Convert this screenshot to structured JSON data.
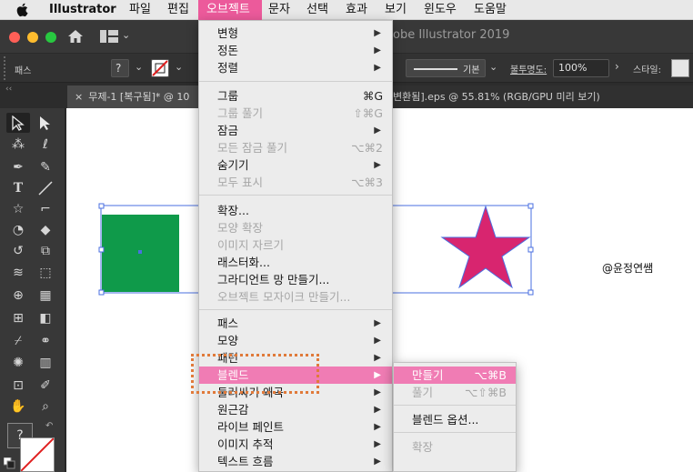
{
  "menubar": {
    "apple": "",
    "app": "Illustrator",
    "items": [
      "파일",
      "편집",
      "오브젝트",
      "문자",
      "선택",
      "효과",
      "보기",
      "윈도우",
      "도움말"
    ]
  },
  "window": {
    "title": "obe Illustrator 2019"
  },
  "control_bar": {
    "label_path": "패스",
    "stroke_label": "기본",
    "opacity_label": "불투명도:",
    "opacity_value": "100%",
    "style_label": "스타일:"
  },
  "tabs": [
    {
      "close": "×",
      "label": "무제-1 [복구됨]* @ 10"
    },
    {
      "label": "변환됨].eps @ 55.81% (RGB/GPU 미리 보기)"
    }
  ],
  "canvas": {
    "watermark": "@윤정연쌤",
    "colors": {
      "rect": "#0f9a4a",
      "star": "#d8256f",
      "selection": "#4a6fe0"
    }
  },
  "object_menu": {
    "items": [
      {
        "label": "변형",
        "shortcut": "",
        "submenu": true,
        "disabled": false
      },
      {
        "label": "정돈",
        "shortcut": "",
        "submenu": true,
        "disabled": false
      },
      {
        "label": "정렬",
        "shortcut": "",
        "submenu": true,
        "disabled": false
      },
      {
        "label": "그룹",
        "shortcut": "⌘G",
        "submenu": false,
        "disabled": false
      },
      {
        "label": "그룹 풀기",
        "shortcut": "⇧⌘G",
        "submenu": false,
        "disabled": true
      },
      {
        "label": "잠금",
        "shortcut": "",
        "submenu": true,
        "disabled": false
      },
      {
        "label": "모든 잠금 풀기",
        "shortcut": "⌥⌘2",
        "submenu": false,
        "disabled": true
      },
      {
        "label": "숨기기",
        "shortcut": "",
        "submenu": true,
        "disabled": false
      },
      {
        "label": "모두 표시",
        "shortcut": "⌥⌘3",
        "submenu": false,
        "disabled": true
      },
      {
        "label": "확장...",
        "shortcut": "",
        "submenu": false,
        "disabled": false
      },
      {
        "label": "모양 확장",
        "shortcut": "",
        "submenu": false,
        "disabled": true
      },
      {
        "label": "이미지 자르기",
        "shortcut": "",
        "submenu": false,
        "disabled": true
      },
      {
        "label": "래스터화...",
        "shortcut": "",
        "submenu": false,
        "disabled": false
      },
      {
        "label": "그라디언트 망 만들기...",
        "shortcut": "",
        "submenu": false,
        "disabled": false
      },
      {
        "label": "오브젝트 모자이크 만들기...",
        "shortcut": "",
        "submenu": false,
        "disabled": true
      },
      {
        "label": "패스",
        "shortcut": "",
        "submenu": true,
        "disabled": false
      },
      {
        "label": "모양",
        "shortcut": "",
        "submenu": true,
        "disabled": false
      },
      {
        "label": "패턴",
        "shortcut": "",
        "submenu": true,
        "disabled": false
      },
      {
        "label": "블렌드",
        "shortcut": "",
        "submenu": true,
        "disabled": false,
        "highlighted": true
      },
      {
        "label": "둘러싸기 왜곡",
        "shortcut": "",
        "submenu": true,
        "disabled": false
      },
      {
        "label": "원근감",
        "shortcut": "",
        "submenu": true,
        "disabled": false
      },
      {
        "label": "라이브 페인트",
        "shortcut": "",
        "submenu": true,
        "disabled": false
      },
      {
        "label": "이미지 추적",
        "shortcut": "",
        "submenu": true,
        "disabled": false
      },
      {
        "label": "텍스트 흐름",
        "shortcut": "",
        "submenu": true,
        "disabled": false
      }
    ]
  },
  "blend_submenu": {
    "items": [
      {
        "label": "만들기",
        "shortcut": "⌥⌘B",
        "disabled": false,
        "highlighted": true
      },
      {
        "label": "풀기",
        "shortcut": "⌥⇧⌘B",
        "disabled": true
      },
      {
        "label": "블렌드 옵션...",
        "shortcut": "",
        "disabled": false
      },
      {
        "label": "확장",
        "shortcut": "",
        "disabled": true
      }
    ]
  },
  "toolbar": {
    "tools": [
      "selection-tool",
      "direct-selection-tool",
      "magic-wand-tool",
      "lasso-tool",
      "pen-tool",
      "curvature-tool",
      "type-tool",
      "line-tool",
      "rectangle-tool",
      "paintbrush-tool",
      "shaper-tool",
      "eraser-tool",
      "rotate-tool",
      "scale-tool",
      "width-tool",
      "free-transform-tool",
      "shape-builder-tool",
      "perspective-grid-tool",
      "mesh-tool",
      "gradient-tool",
      "eyedropper-tool",
      "blend-tool",
      "symbol-sprayer-tool",
      "column-graph-tool",
      "artboard-tool",
      "slice-tool",
      "hand-tool",
      "zoom-tool"
    ],
    "fill_icon": "?"
  }
}
